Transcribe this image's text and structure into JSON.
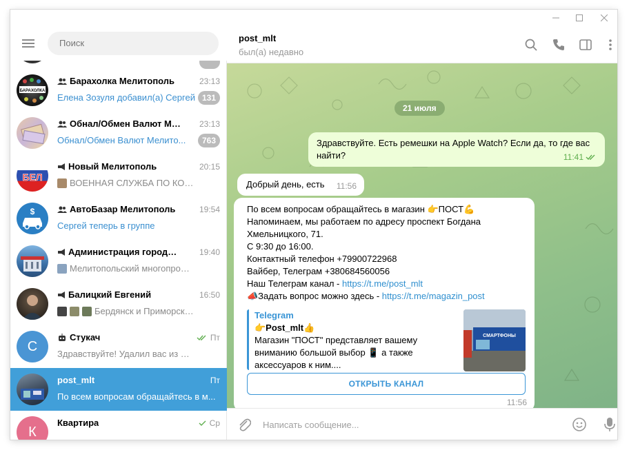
{
  "search": {
    "placeholder": "Поиск"
  },
  "chats": [
    {
      "name": "Барахолка Мелитополь",
      "time": "23:13",
      "preview": "Елена Зозуля добавил(а) Сергей",
      "badge": "131",
      "type": "group"
    },
    {
      "name": "Обнал/Обмен Валют Мел...",
      "time": "23:13",
      "preview": "Обнал/Обмен Валют Мелито...",
      "badge": "763",
      "type": "group"
    },
    {
      "name": "Новый Мелитополь",
      "time": "20:15",
      "preview": "ВОЕННАЯ СЛУЖБА ПО КОНТРАК...",
      "type": "channel"
    },
    {
      "name": "АвтоБазар Мелитополь",
      "time": "19:54",
      "preview": "Сергей теперь в группе",
      "type": "group"
    },
    {
      "name": "Администрация города ...",
      "time": "19:40",
      "preview": "Мелитопольский многопрофил...",
      "type": "channel"
    },
    {
      "name": "Балицкий Евгений",
      "time": "16:50",
      "preview": "Бердянск и Приморск Запо...",
      "type": "channel"
    },
    {
      "name": "Стукач",
      "time": "Пт",
      "preview": "Здравствуйте! Удалил вас из ЧС.",
      "avatar_letter": "С",
      "type": "bot"
    },
    {
      "name": "post_mlt",
      "time": "Пт",
      "preview": "По всем вопросам обращайтесь в м...",
      "type": "user"
    },
    {
      "name": "Квартира",
      "time": "Ср",
      "avatar_letter": "К",
      "type": "user"
    }
  ],
  "header": {
    "peer_name": "post_mlt",
    "peer_status": "был(а) недавно"
  },
  "messages": {
    "date": "21 июля",
    "out1": {
      "line1": "Здравствуйте. Есть ремешки на Apple Watch? Если да, то где вас",
      "line2": "найти?",
      "time": "11:41"
    },
    "in1": {
      "text": "Добрый день, есть",
      "time": "11:56"
    },
    "in2": {
      "line1": "По всем вопросам обращайтесь в магазин  👉ПОСТ💪",
      "line2": "Напоминаем, мы работаем по адресу проспект Богдана",
      "line3": "Хмельницкого, 71.",
      "line4": "С 9:30 до 16:00.",
      "line5": "Контактный телефон +79900722968",
      "line6": "Вайбер, Телеграм +380684560056",
      "line7_prefix": "Наш Телеграм канал -  ",
      "line7_link": "https://t.me/post_mlt",
      "line8_prefix": "📣Задать вопрос можно здесь - ",
      "line8_link": "https://t.me/magazin_post",
      "preview_site": "Telegram",
      "preview_title": "👉Post_mlt👍",
      "preview_desc1": "Магазин \"ПОСТ\" представляет вашему",
      "preview_desc2": "вниманию большой выбор 📱 а также",
      "preview_desc3": "аксессуаров к ним....",
      "preview_img_text": "СМАРТФОНЫ",
      "open_button": "ОТКРЫТЬ КАНАЛ",
      "time": "11:56"
    }
  },
  "composer": {
    "placeholder": "Написать сообщение..."
  },
  "colors": {
    "accent": "#419fd9",
    "out_bubble": "#eefed9",
    "badge": "#bbbbbb",
    "link": "#2f8fcf"
  }
}
